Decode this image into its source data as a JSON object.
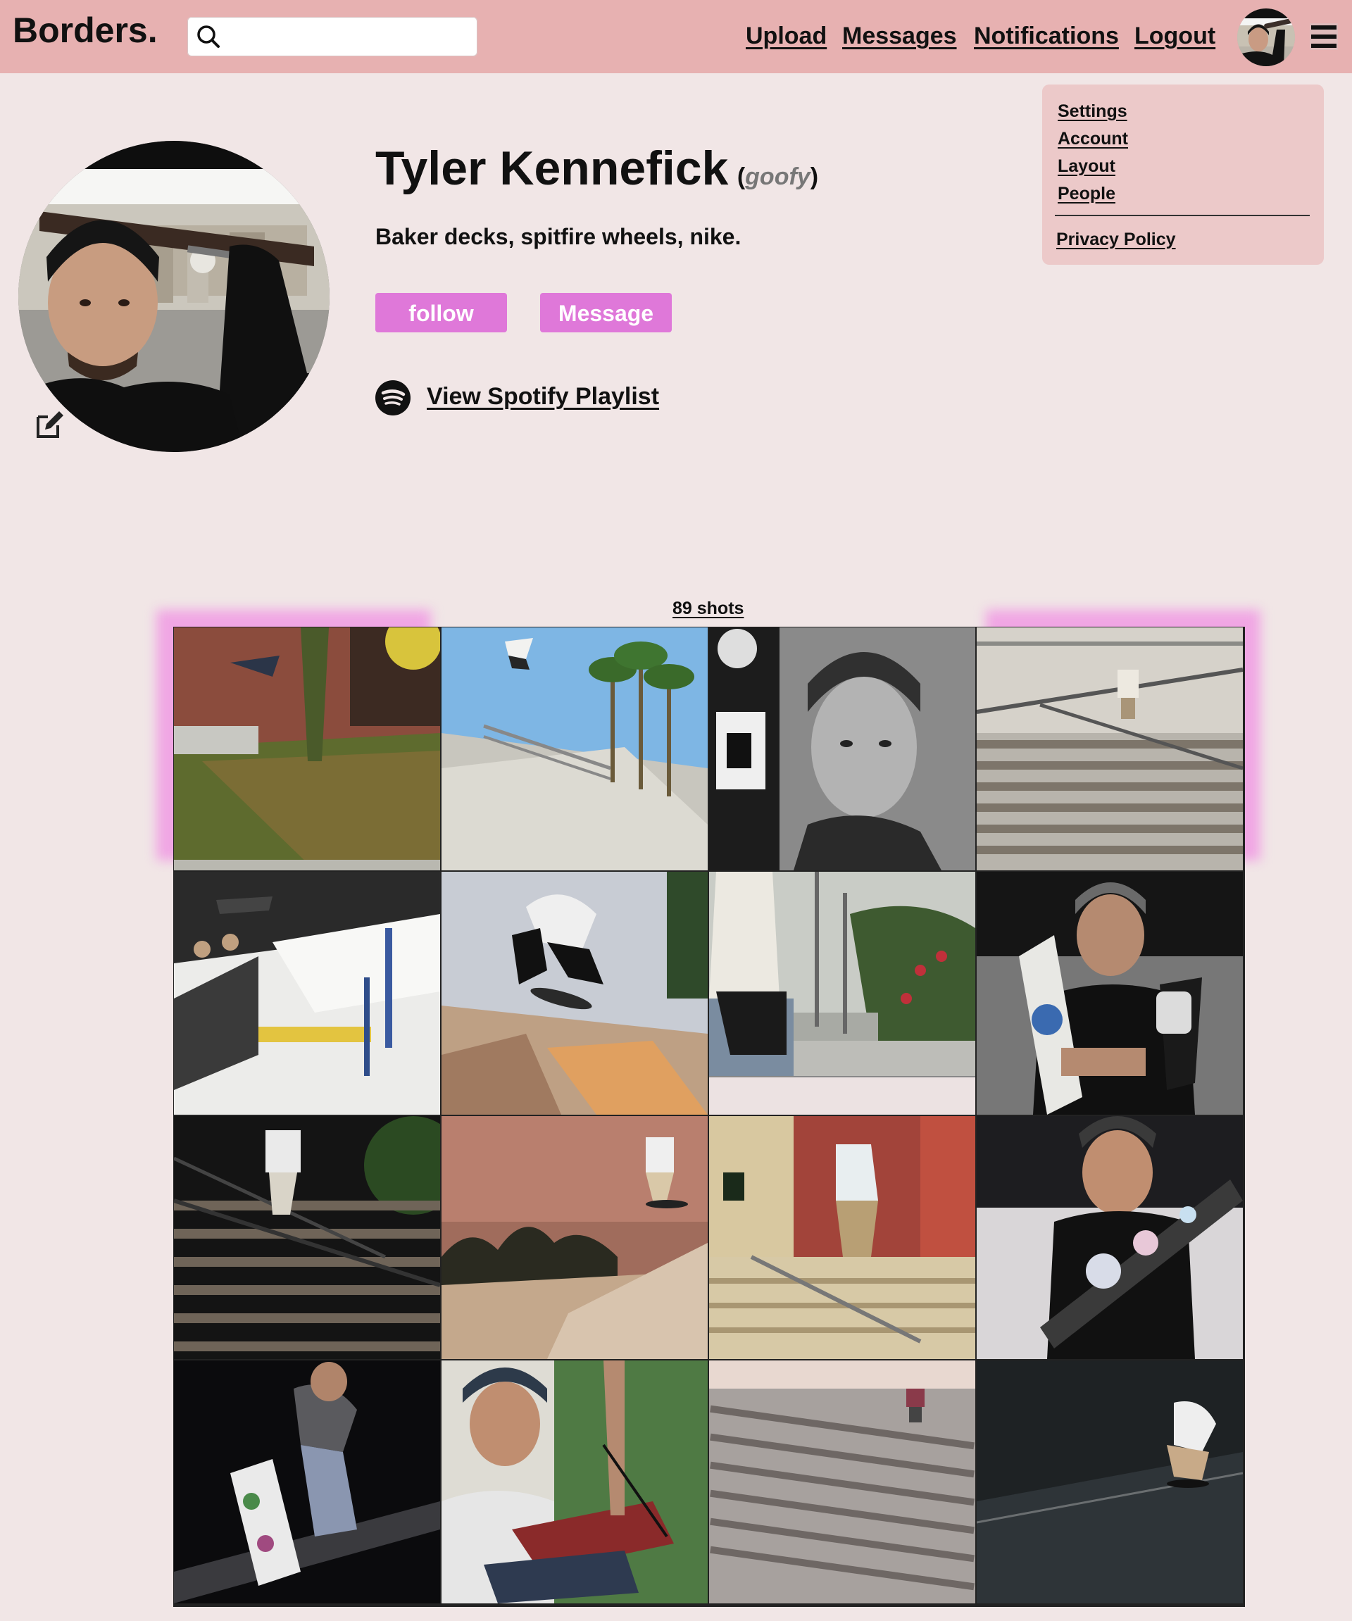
{
  "header": {
    "logo": "Borders.",
    "search": {
      "placeholder": "",
      "value": ""
    },
    "nav": {
      "upload": "Upload",
      "messages": "Messages",
      "notifications": "Notifications",
      "logout": "Logout"
    },
    "avatar_icon": "user-avatar",
    "menu_icon": "hamburger-menu-icon"
  },
  "dropdown": {
    "items": [
      "Settings",
      "Account",
      "Layout",
      "People"
    ],
    "privacy": "Privacy Policy"
  },
  "profile": {
    "name": "Tyler Kennefick",
    "stance_open": "(",
    "stance": "goofy",
    "stance_close": ")",
    "bio": "Baker decks, spitfire wheels, nike.",
    "follow_label": "follow",
    "message_label": "Message",
    "spotify_label": "View Spotify Playlist",
    "spotify_icon": "spotify-icon",
    "edit_icon": "edit-icon"
  },
  "shots": {
    "count_label": "89 shots",
    "items": [
      "skate-photo-1",
      "skate-photo-2",
      "skate-photo-3",
      "skate-photo-4",
      "skate-photo-5",
      "skate-photo-6",
      "skate-photo-7",
      "skate-photo-8",
      "skate-photo-9",
      "skate-photo-10",
      "skate-photo-11",
      "skate-photo-12",
      "skate-photo-13",
      "skate-photo-14",
      "skate-photo-15",
      "skate-photo-16"
    ]
  },
  "colors": {
    "header_bg": "#e7b1b1",
    "page_bg": "#f1e6e6",
    "dropdown_bg": "#ecc9c9",
    "button_bg": "#df78d9",
    "glow": "#f0a6e4"
  }
}
